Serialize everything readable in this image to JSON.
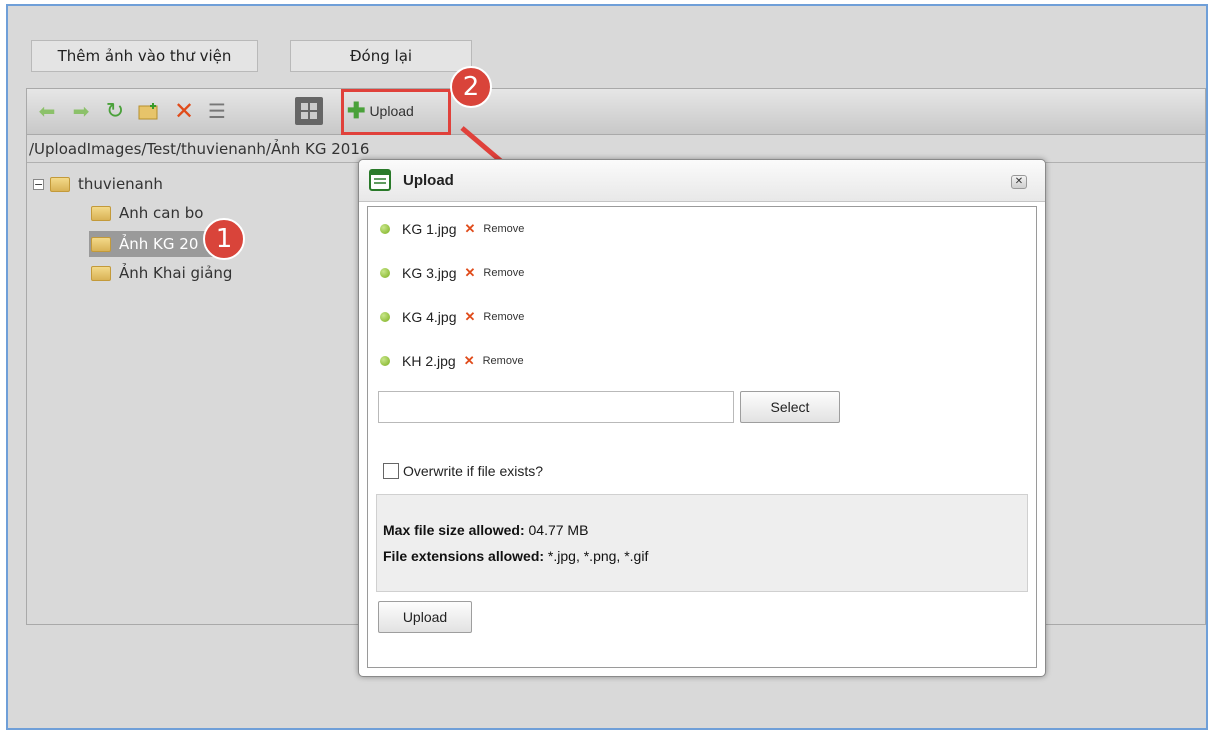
{
  "top_buttons": {
    "add_to_library": "Thêm ảnh vào thư viện",
    "close": "Đóng lại"
  },
  "toolbar": {
    "upload_label": "Upload"
  },
  "path": "/UploadImages/Test/thuvienanh/Ảnh KG 2016",
  "tree": {
    "root": "thuvienanh",
    "children": [
      "Anh can bo",
      "Ảnh KG 20",
      "Ảnh Khai giảng"
    ]
  },
  "dialog": {
    "title": "Upload",
    "files": [
      {
        "name": "KG 1.jpg",
        "remove": "Remove"
      },
      {
        "name": "KG 3.jpg",
        "remove": "Remove"
      },
      {
        "name": "KG 4.jpg",
        "remove": "Remove"
      },
      {
        "name": "KH 2.jpg",
        "remove": "Remove"
      }
    ],
    "file_input_value": "",
    "select_label": "Select",
    "overwrite_label": "Overwrite if file exists?",
    "max_size_label": "Max file size allowed:",
    "max_size_value": " 04.77 MB",
    "extensions_label": "File extensions allowed:",
    "extensions_value": " *.jpg, *.png, *.gif",
    "upload_label": "Upload"
  },
  "annotations": {
    "badge1": "1",
    "badge2": "2"
  },
  "colors": {
    "accent_red": "#e0413b",
    "window_border": "#6f9fd8",
    "delete_red": "#e04b1a"
  }
}
